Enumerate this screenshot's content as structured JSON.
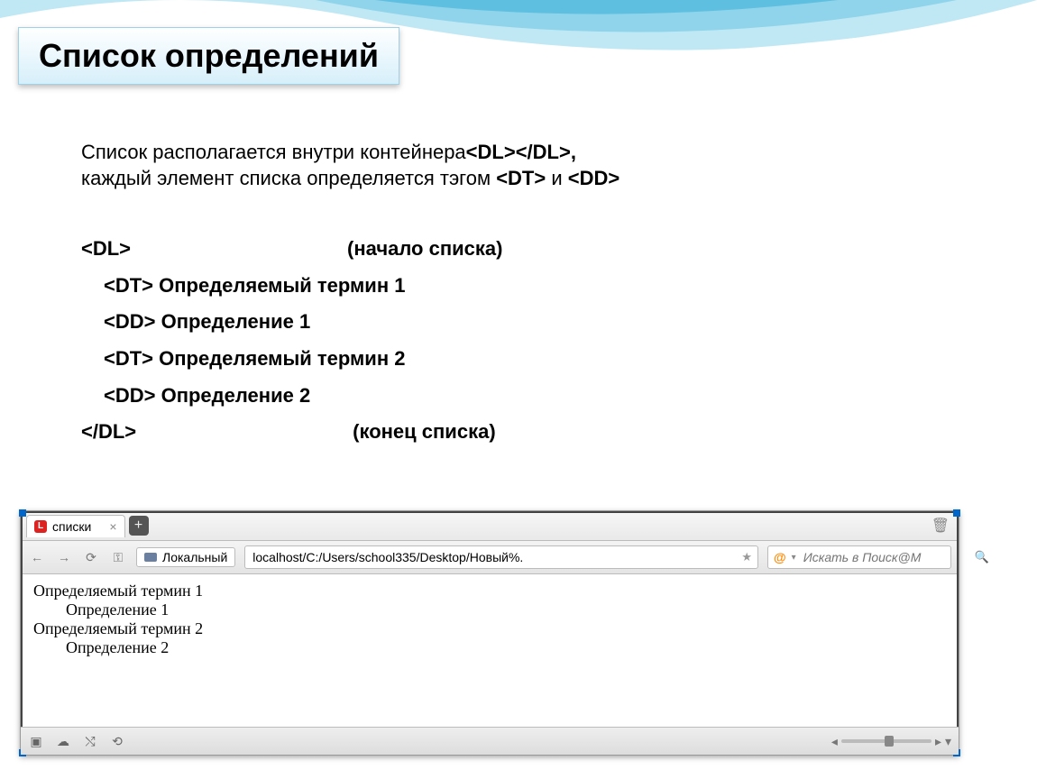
{
  "slide": {
    "title": "Список определений",
    "desc_part1": "Список располагается внутри контейнера",
    "desc_tag1a": "<DL>",
    "desc_tag1b": "</DL>,",
    "desc_part2": "каждый элемент списка определяется тэгом ",
    "desc_tag2a": "<DT>",
    "desc_and": " и ",
    "desc_tag2b": "<DD>"
  },
  "code": {
    "l1_tag": "<DL>",
    "l1_comment": "(начало списка)",
    "l2_tag": "<DT>",
    "l2_text": " Определяемый термин 1",
    "l3_tag": "<DD>",
    "l3_text": " Определение 1",
    "l4_tag": "<DT>",
    "l4_text": " Определяемый термин 2",
    "l5_tag": "<DD>",
    "l5_text": " Определение 2",
    "l6_tag": "</DL>",
    "l6_comment": "(конец списка)"
  },
  "browser": {
    "tab_title": "списки",
    "local_label": "Локальный",
    "address": "localhost/C:/Users/school335/Desktop/Новый%.",
    "search_placeholder": "Искать в Поиск@М",
    "body": {
      "dt1": "Определяемый термин 1",
      "dd1": "Определение 1",
      "dt2": "Определяемый термин 2",
      "dd2": "Определение 2"
    }
  },
  "icons": {
    "tab": "L",
    "close": "×",
    "plus": "+",
    "trash": "🗑",
    "back": "←",
    "forward": "→",
    "reload": "⟳",
    "key": "⚿",
    "star": "★",
    "at": "@",
    "search": "🔍",
    "panel": "▣",
    "cloud": "☁",
    "share": "⤭",
    "sync": "⟲",
    "zoom_left": "◂",
    "zoom_right": "▸",
    "dropdown": "▾"
  }
}
